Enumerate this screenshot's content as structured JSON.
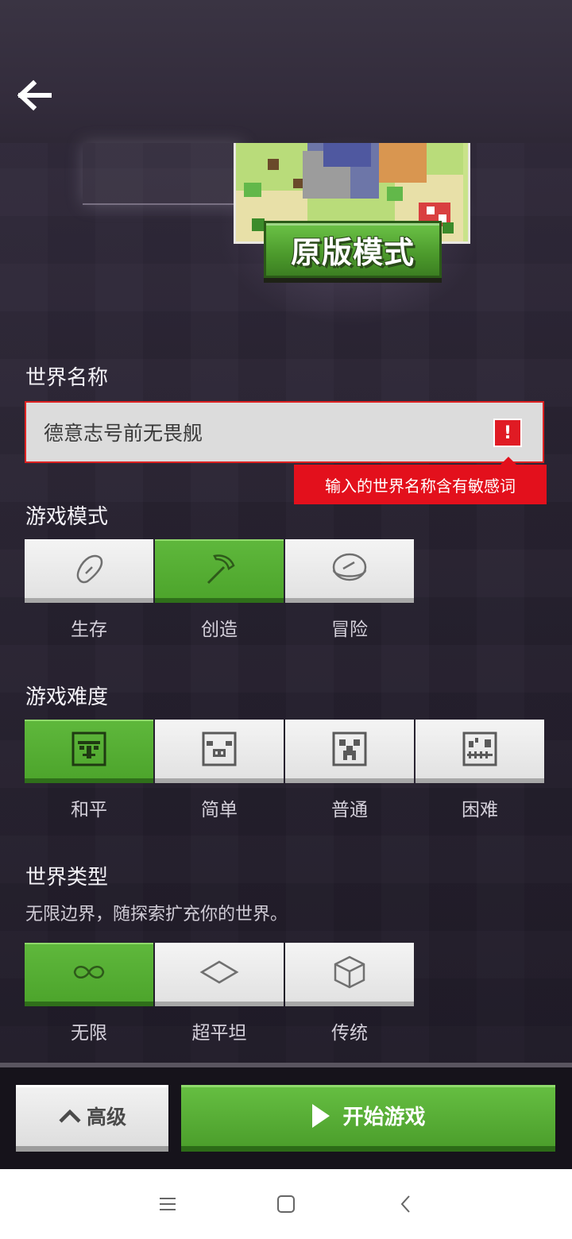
{
  "hero": {
    "badge_text": "原版模式"
  },
  "world_name": {
    "label": "世界名称",
    "value": "德意志号前无畏舰",
    "error_icon": "!",
    "error_text": "输入的世界名称含有敏感词"
  },
  "game_mode": {
    "label": "游戏模式",
    "options": [
      {
        "label": "生存",
        "icon": "potato-icon",
        "selected": false
      },
      {
        "label": "创造",
        "icon": "pickaxe-icon",
        "selected": true
      },
      {
        "label": "冒险",
        "icon": "compass-icon",
        "selected": false
      }
    ]
  },
  "difficulty": {
    "label": "游戏难度",
    "options": [
      {
        "label": "和平",
        "icon": "villager-icon",
        "selected": true
      },
      {
        "label": "简单",
        "icon": "pig-icon",
        "selected": false
      },
      {
        "label": "普通",
        "icon": "creeper-icon",
        "selected": false
      },
      {
        "label": "困难",
        "icon": "skeleton-icon",
        "selected": false
      }
    ]
  },
  "world_type": {
    "label": "世界类型",
    "description": "无限边界，随探索扩充你的世界。",
    "options": [
      {
        "label": "无限",
        "icon": "infinity-icon",
        "selected": true
      },
      {
        "label": "超平坦",
        "icon": "flat-icon",
        "selected": false
      },
      {
        "label": "传统",
        "icon": "cube-icon",
        "selected": false
      }
    ]
  },
  "footer": {
    "advanced_label": "高级",
    "start_label": "开始游戏"
  },
  "colors": {
    "accent_green": "#4da52c",
    "error_red": "#e3101c"
  }
}
